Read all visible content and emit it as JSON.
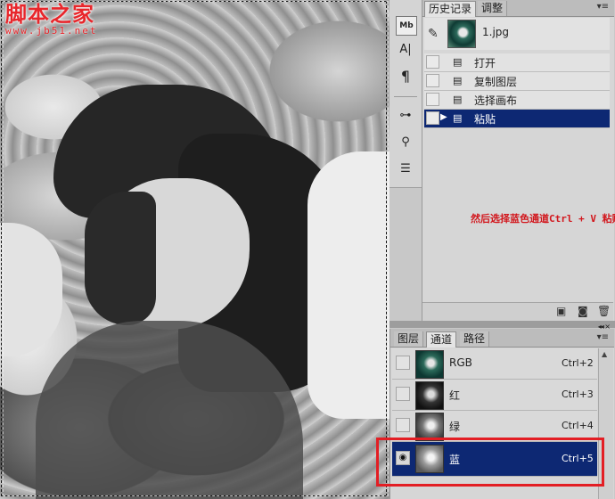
{
  "watermark": {
    "logo": "脚本之家",
    "url": "www.jb51.net"
  },
  "tools": [
    {
      "icon": "text-box-icon",
      "glyph": "Mb"
    },
    {
      "icon": "character-icon",
      "glyph": "A|"
    },
    {
      "icon": "paragraph-icon",
      "glyph": "¶"
    },
    {
      "icon": "adjust-sliders-icon",
      "glyph": "⊶"
    },
    {
      "icon": "clone-source-icon",
      "glyph": "⚲"
    },
    {
      "icon": "tool-presets-icon",
      "glyph": "☰"
    }
  ],
  "history_panel": {
    "tabs": [
      {
        "label": "历史记录",
        "active": true
      },
      {
        "label": "调整",
        "active": false
      }
    ],
    "snapshot": {
      "label": "1.jpg"
    },
    "items": [
      {
        "label": "打开",
        "active": false
      },
      {
        "label": "复制图层",
        "active": false
      },
      {
        "label": "选择画布",
        "active": false
      },
      {
        "label": "粘贴",
        "active": true
      }
    ],
    "annotation": "然后选择蓝色通道Ctrl + V 粘贴"
  },
  "channels_panel": {
    "tabs": [
      {
        "label": "图层",
        "active": false
      },
      {
        "label": "通道",
        "active": true
      },
      {
        "label": "路径",
        "active": false
      }
    ],
    "channels": [
      {
        "name": "RGB",
        "shortcut": "Ctrl+2",
        "visible": false,
        "active": false,
        "thumb": "color"
      },
      {
        "name": "红",
        "shortcut": "Ctrl+3",
        "visible": false,
        "active": false,
        "thumb": "gray-dark"
      },
      {
        "name": "绿",
        "shortcut": "Ctrl+4",
        "visible": false,
        "active": false,
        "thumb": "gray-mid"
      },
      {
        "name": "蓝",
        "shortcut": "Ctrl+5",
        "visible": true,
        "active": true,
        "thumb": "gray-light"
      }
    ]
  },
  "colors": {
    "selection_blue": "#0d2873",
    "highlight_red": "#e31e24",
    "annotation_red": "#d2161c"
  }
}
